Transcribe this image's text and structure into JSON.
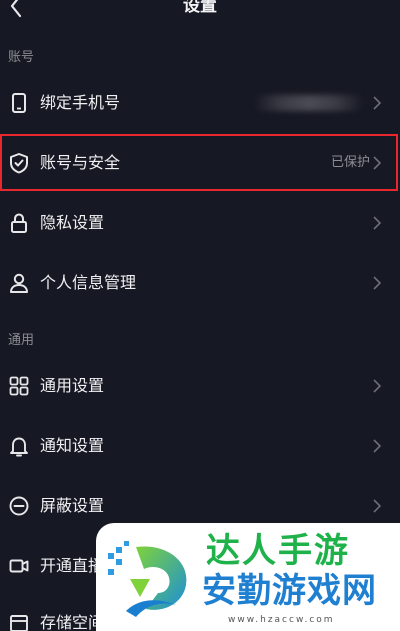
{
  "header": {
    "title": "设置"
  },
  "sections": {
    "account": "账号",
    "general": "通用"
  },
  "rows": [
    {
      "label": "绑定手机号",
      "value": "",
      "icon": "phone-icon"
    },
    {
      "label": "账号与安全",
      "value": "已保护",
      "icon": "shield-check-icon"
    },
    {
      "label": "隐私设置",
      "value": "",
      "icon": "lock-icon"
    },
    {
      "label": "个人信息管理",
      "value": "",
      "icon": "person-icon"
    },
    {
      "label": "通用设置",
      "value": "",
      "icon": "grid-icon"
    },
    {
      "label": "通知设置",
      "value": "",
      "icon": "bell-icon"
    },
    {
      "label": "屏蔽设置",
      "value": "",
      "icon": "block-icon"
    },
    {
      "label": "开通直播",
      "value": "",
      "icon": "video-camera-icon"
    },
    {
      "label": "存储空间",
      "value": "",
      "icon": "storage-icon"
    }
  ],
  "watermark": {
    "line1": "达人手游",
    "line2": "安勤游戏网",
    "url": "www.hzaccw.com"
  },
  "colors": {
    "background": "#161823",
    "highlight": "#e8282e",
    "watermark_green": "#1fb24a",
    "watermark_blue": "#1f7fd1"
  }
}
